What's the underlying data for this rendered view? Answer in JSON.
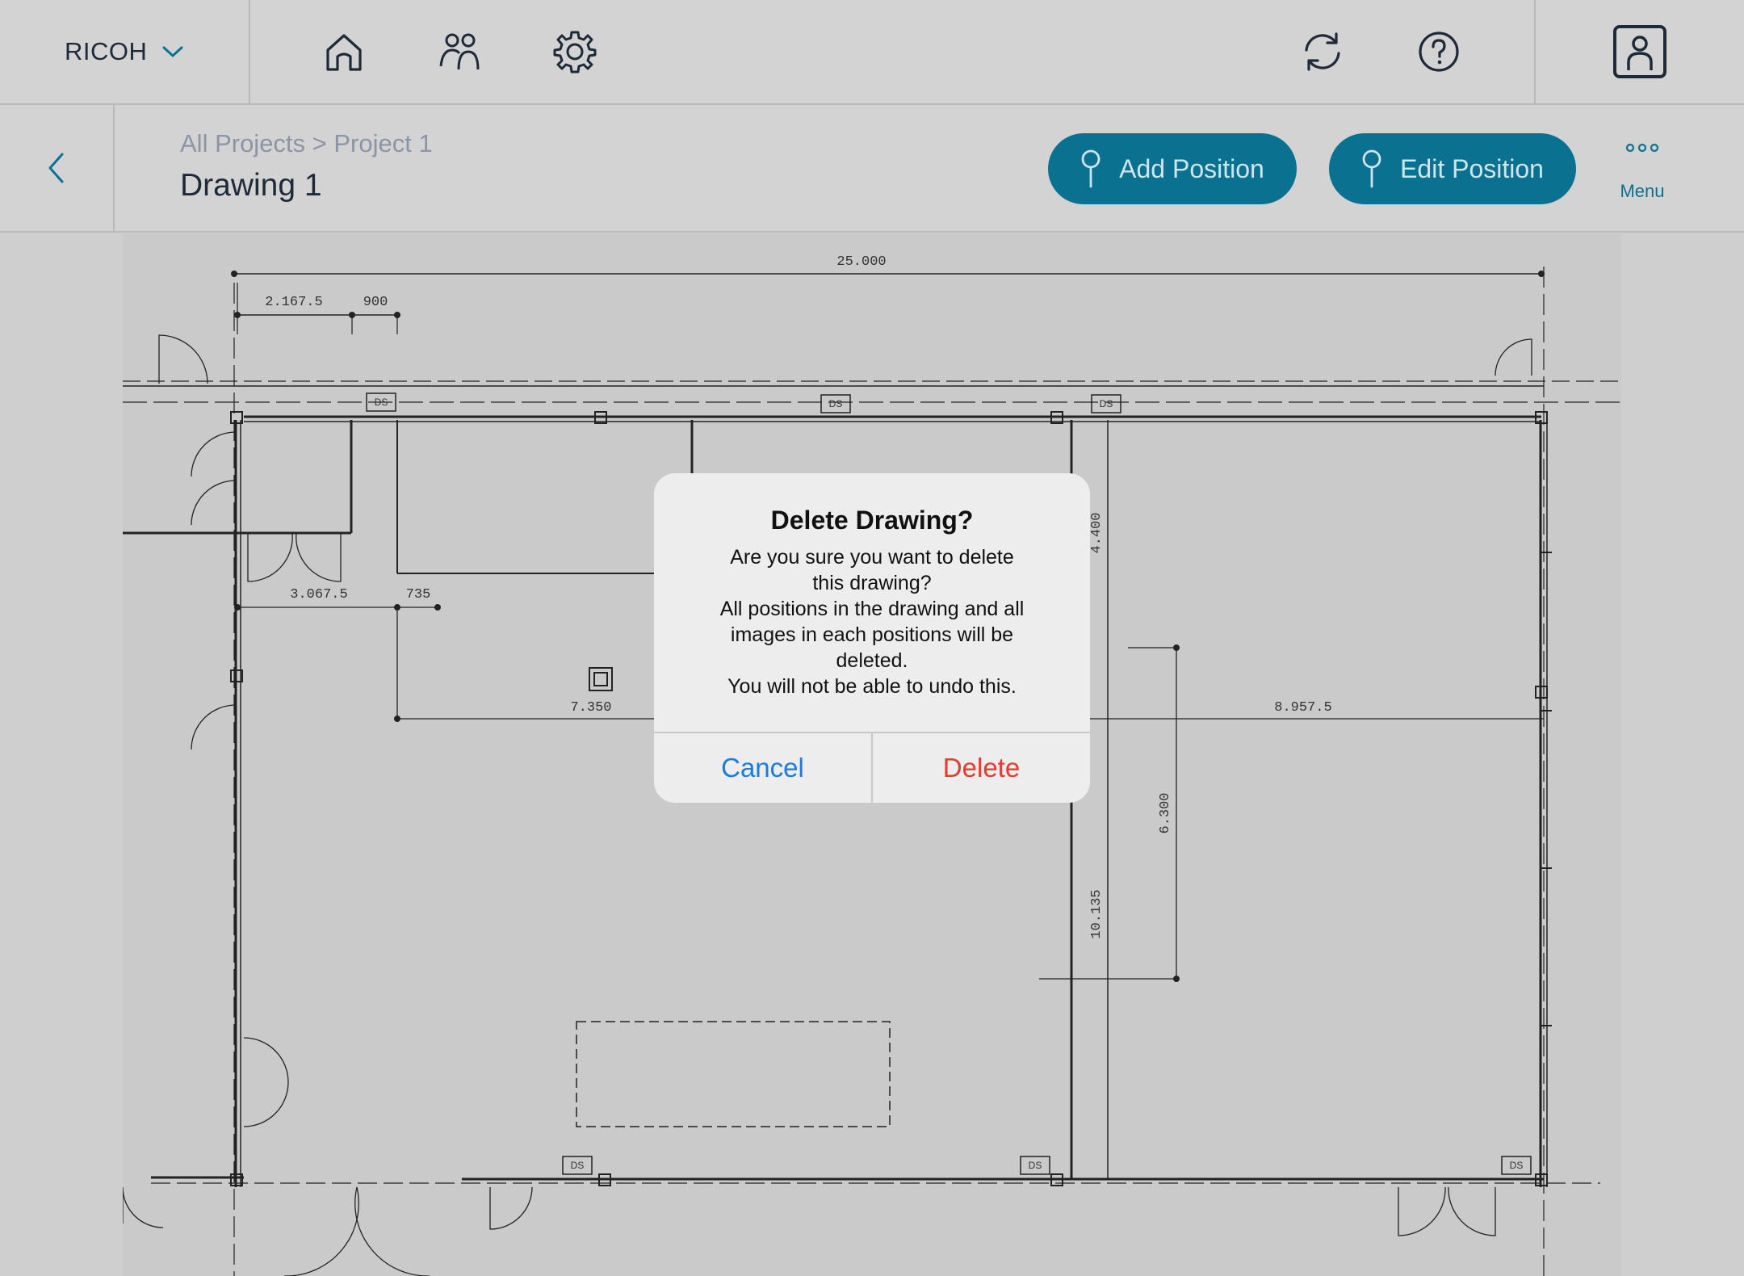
{
  "header": {
    "org_name": "RICOH",
    "icons": [
      "chevron-down-icon",
      "home-icon",
      "users-icon",
      "gear-icon",
      "sync-icon",
      "help-icon",
      "profile-icon"
    ]
  },
  "subheader": {
    "breadcrumb": "All Projects > Project 1",
    "title": "Drawing 1",
    "add_position_label": "Add Position",
    "edit_position_label": "Edit Position",
    "menu_label": "Menu"
  },
  "drawing": {
    "dims": [
      "25.000",
      "2.167.5",
      "900",
      "3.067.5",
      "735",
      "7.350",
      "4.400",
      "8.957.5",
      "6.300",
      "10.135"
    ],
    "tags": [
      "DS",
      "DS",
      "DS",
      "DS",
      "DS",
      "DS"
    ]
  },
  "dialog": {
    "title": "Delete Drawing?",
    "message": "Are you sure you want to delete\nthis drawing?\nAll positions in the drawing and all\nimages in each positions will be\ndeleted.\nYou will not be able to undo this.",
    "cancel_label": "Cancel",
    "delete_label": "Delete"
  },
  "colors": {
    "accent": "#0b7191",
    "link_blue": "#1a7ce0",
    "destructive_red": "#e8392f"
  }
}
